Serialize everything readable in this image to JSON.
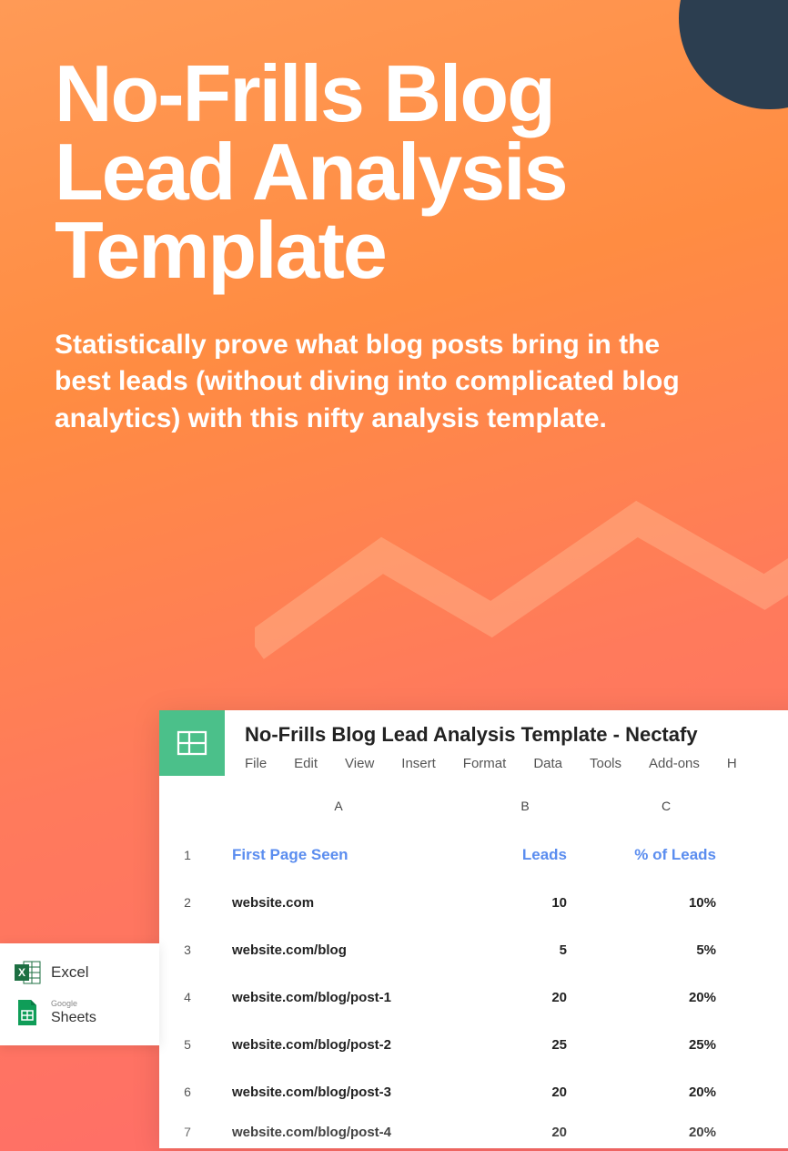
{
  "hero": {
    "title": "No-Frills Blog Lead Analysis Template",
    "subtitle": "Statistically prove what blog posts bring in the best leads (without diving into complicated blog analytics) with this nifty analysis template."
  },
  "spreadsheet": {
    "title": "No-Frills Blog Lead Analysis Template - Nectafy",
    "menu": [
      "File",
      "Edit",
      "View",
      "Insert",
      "Format",
      "Data",
      "Tools",
      "Add-ons",
      "H"
    ],
    "columns": [
      "A",
      "B",
      "C"
    ],
    "headers": {
      "a": "First Page Seen",
      "b": "Leads",
      "c": "% of Leads"
    },
    "rows": [
      {
        "n": "1",
        "a": "",
        "b": "",
        "c": ""
      },
      {
        "n": "2",
        "a": "website.com",
        "b": "10",
        "c": "10%"
      },
      {
        "n": "3",
        "a": "website.com/blog",
        "b": "5",
        "c": "5%"
      },
      {
        "n": "4",
        "a": "website.com/blog/post-1",
        "b": "20",
        "c": "20%"
      },
      {
        "n": "5",
        "a": "website.com/blog/post-2",
        "b": "25",
        "c": "25%"
      },
      {
        "n": "6",
        "a": "website.com/blog/post-3",
        "b": "20",
        "c": "20%"
      },
      {
        "n": "7",
        "a": "website.com/blog/post-4",
        "b": "20",
        "c": "20%"
      }
    ]
  },
  "badges": {
    "excel": "Excel",
    "sheets_small": "Google",
    "sheets_main": "Sheets"
  }
}
